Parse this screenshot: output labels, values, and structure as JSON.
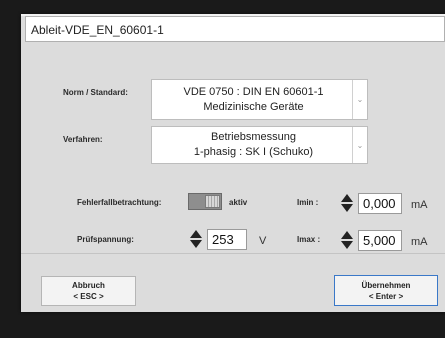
{
  "title_field": {
    "value": "Ableit-VDE_EN_60601-1"
  },
  "norm": {
    "label": "Norm / Standard:",
    "line1": "VDE 0750 : DIN EN 60601-1",
    "line2": "Medizinische Geräte"
  },
  "verfahren": {
    "label": "Verfahren:",
    "line1": "Betriebsmessung",
    "line2": "1-phasig : SK I (Schuko)"
  },
  "fehlerfall": {
    "label": "Fehlerfallbetrachtung:",
    "state": "aktiv"
  },
  "pruefspannung": {
    "label": "Prüfspannung:",
    "value": "253",
    "unit": "V"
  },
  "imin": {
    "label": "Imin :",
    "value": "0,000",
    "unit": "mA"
  },
  "imax": {
    "label": "Imax :",
    "value": "5,000",
    "unit": "mA"
  },
  "buttons": {
    "abbruch_line1": "Abbruch",
    "abbruch_line2": "< ESC >",
    "uebernehmen_line1": "Übernehmen",
    "uebernehmen_line2": "< Enter >"
  },
  "icons": {
    "dropdown": "chevron-down-icon",
    "spin": "up-down-arrows-icon",
    "toggle": "toggle-switch-icon"
  }
}
